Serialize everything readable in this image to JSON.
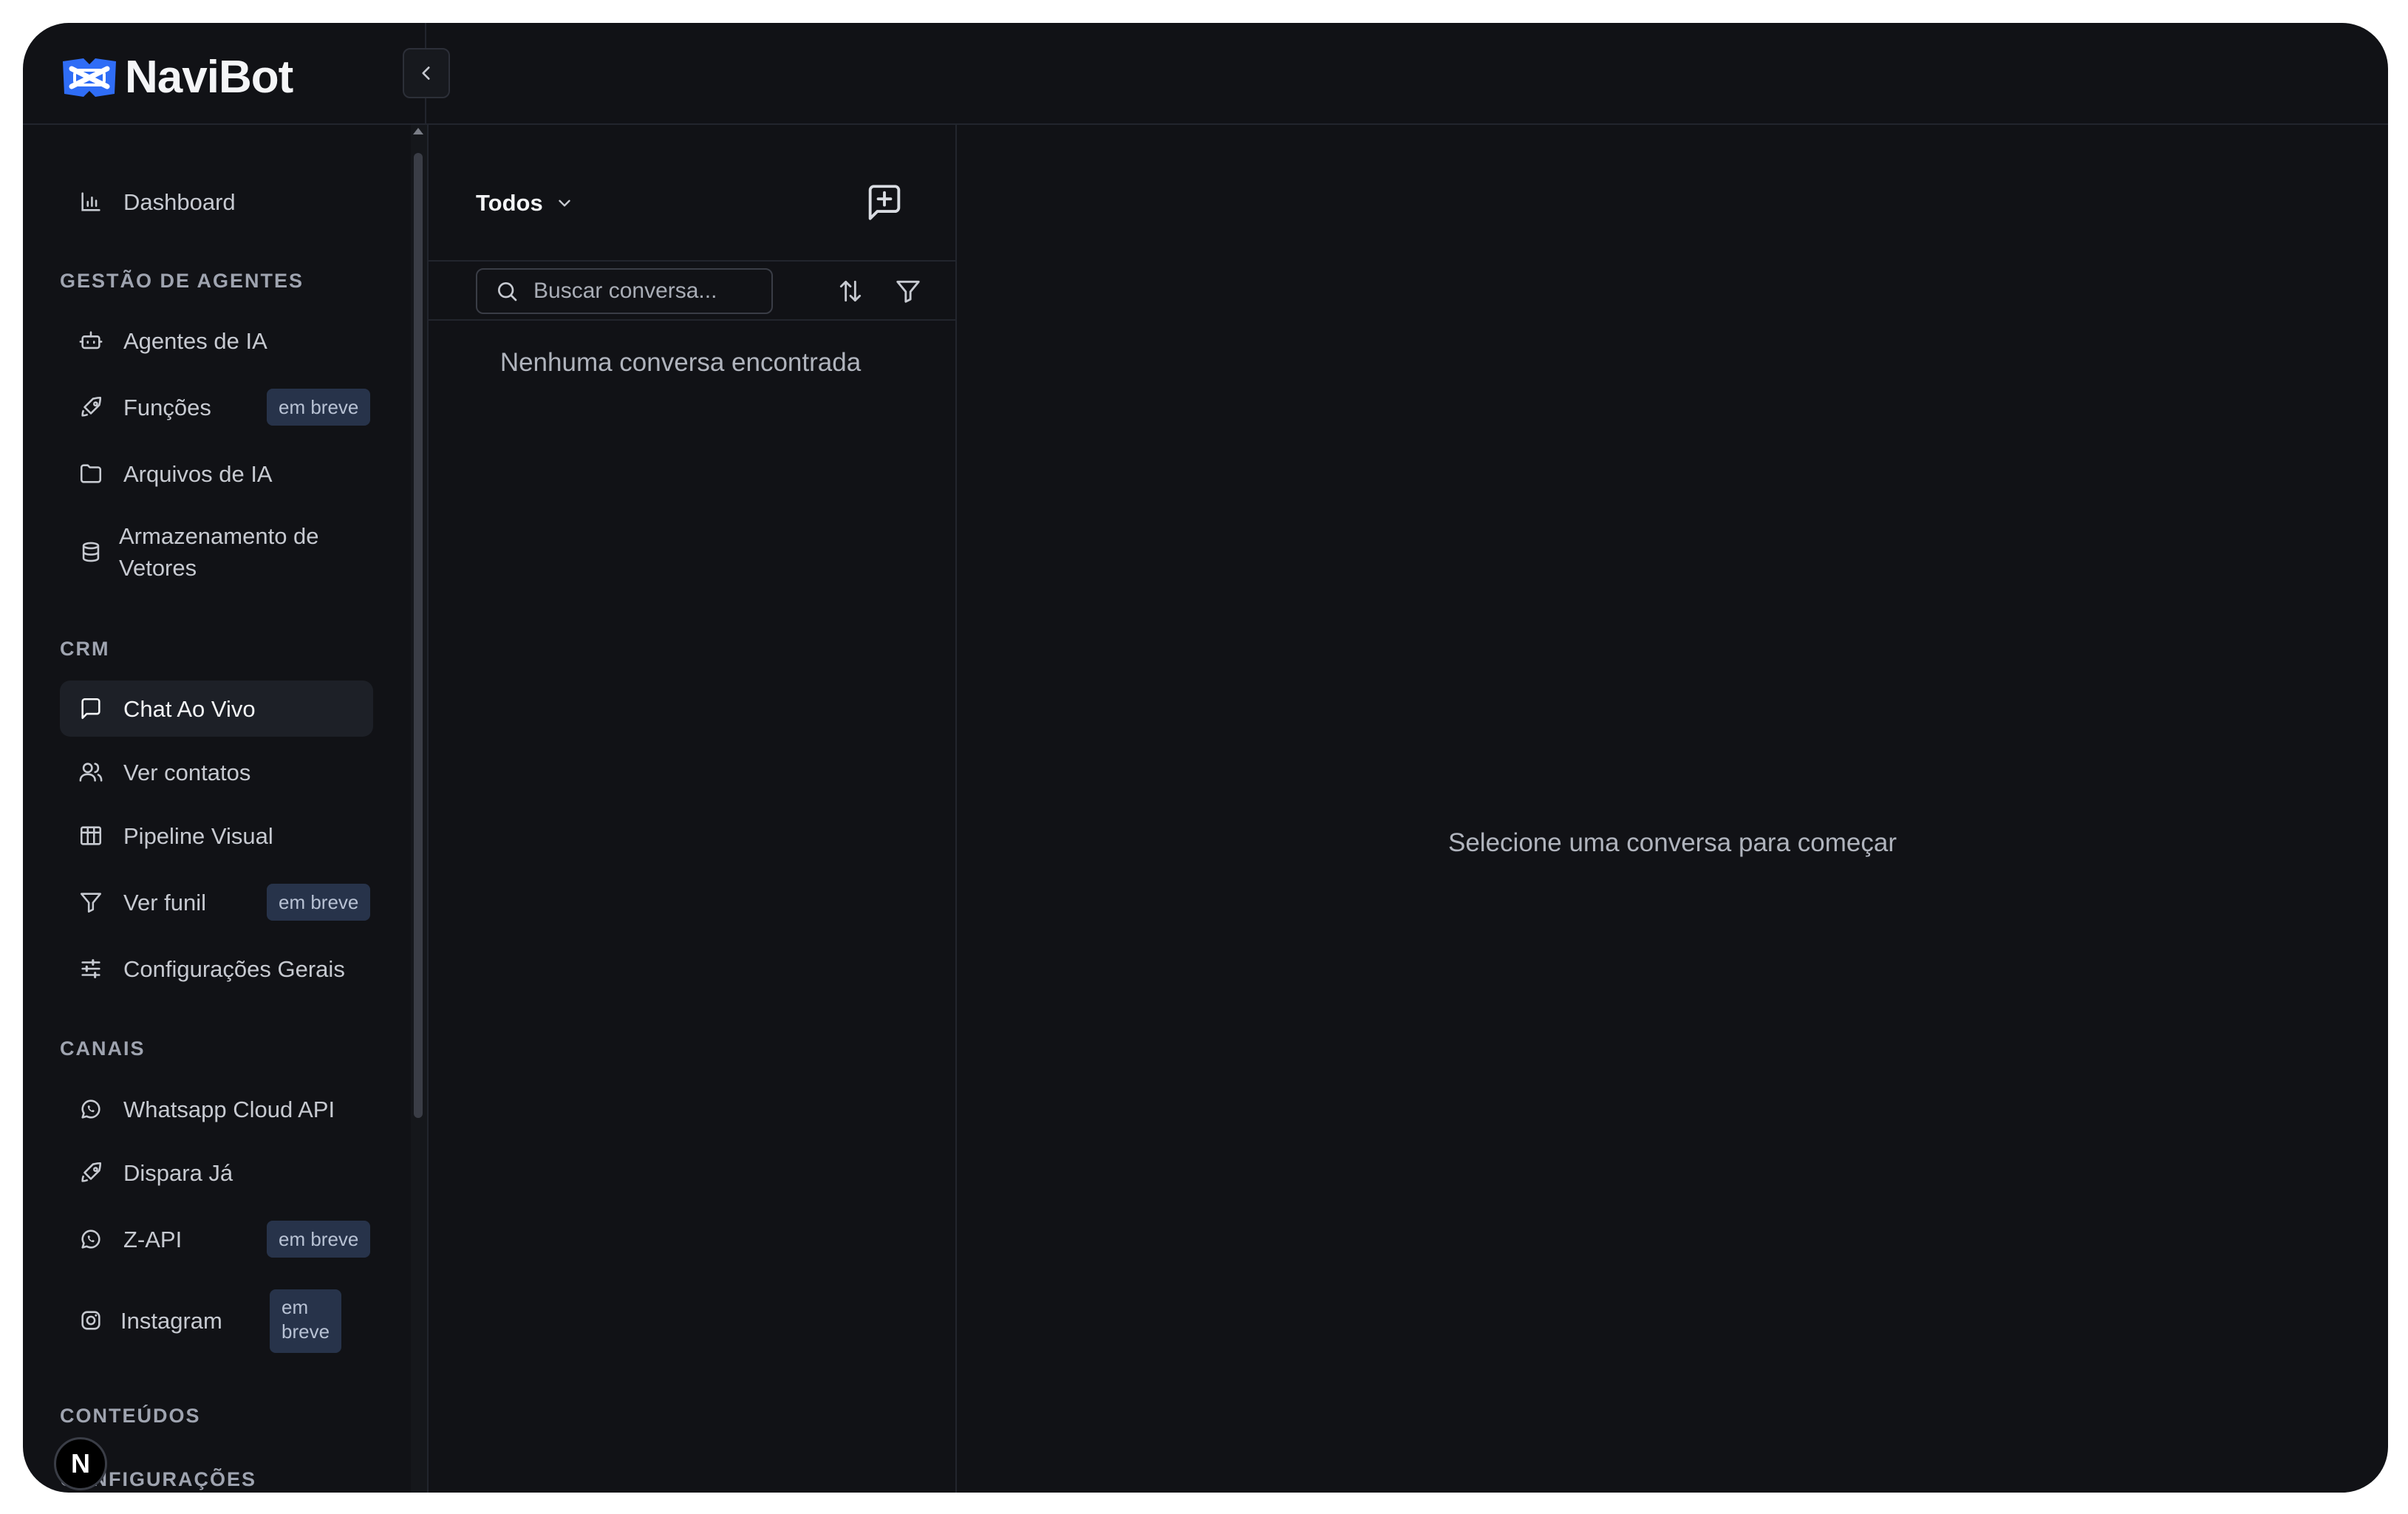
{
  "app": {
    "name": "NaviBot"
  },
  "sidebar": {
    "dashboard": "Dashboard",
    "sections": {
      "agents": "GESTÃO DE AGENTES",
      "crm": "CRM",
      "channels": "CANAIS",
      "contents": "CONTEÚDOS",
      "settings": "CONFIGURAÇÕES"
    },
    "items": {
      "agentes": "Agentes de IA",
      "funcoes": "Funções",
      "arquivos": "Arquivos de IA",
      "armazenamento_l1": "Armazenamento de",
      "armazenamento_l2": "Vetores",
      "chat": "Chat Ao Vivo",
      "contatos": "Ver contatos",
      "pipeline": "Pipeline Visual",
      "funil": "Ver funil",
      "config": "Configurações Gerais",
      "whatsapp": "Whatsapp Cloud API",
      "dispara": "Dispara Já",
      "zapi": "Z-API",
      "instagram": "Instagram"
    },
    "badge_soon": "em breve",
    "badge_soon_l1": "em",
    "badge_soon_l2": "breve",
    "avatar_letter": "N"
  },
  "conversations": {
    "filter_label": "Todos",
    "search_placeholder": "Buscar conversa...",
    "search_value": "",
    "empty_message": "Nenhuma conversa encontrada"
  },
  "main": {
    "empty_message": "Selecione uma conversa para começar"
  },
  "colors": {
    "background": "#111216",
    "active_item": "#1d2027",
    "badge_bg": "#27334a",
    "border": "#22252d"
  }
}
